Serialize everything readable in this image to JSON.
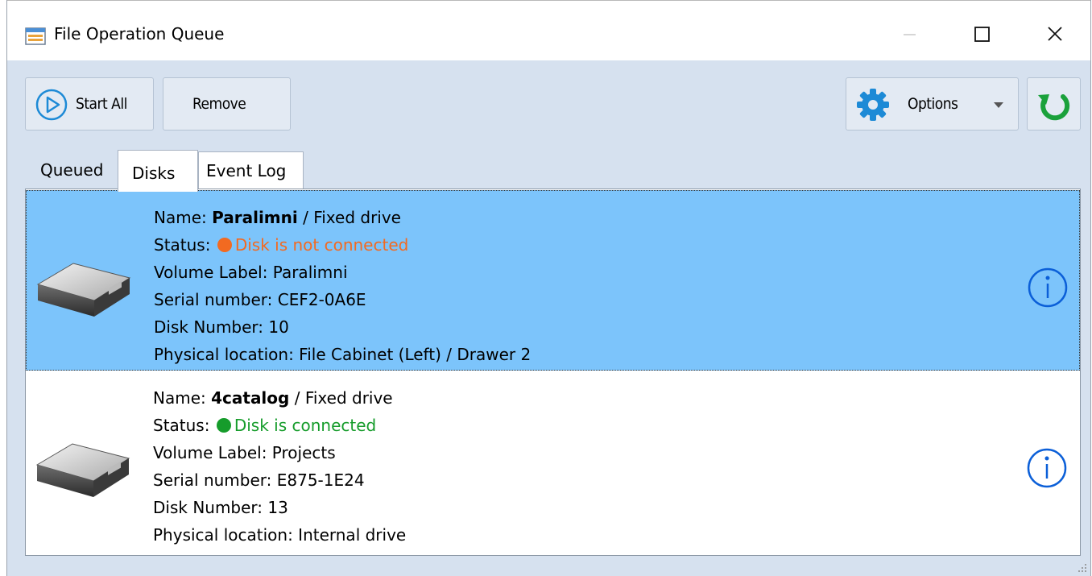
{
  "window": {
    "title": "File Operation Queue"
  },
  "toolbar": {
    "start_all_label": "Start All",
    "remove_label": "Remove",
    "options_label": "Options"
  },
  "tabs": [
    {
      "label": "Queued",
      "active": false
    },
    {
      "label": "Disks",
      "active": true
    },
    {
      "label": "Event Log",
      "active": false
    }
  ],
  "disks": [
    {
      "name_prefix": "Name: ",
      "name": "Paralimni",
      "type": " / Fixed drive",
      "status_prefix": "Status: ",
      "status": "Disk is not connected",
      "status_color": "#f26a21",
      "volume_label": "Volume Label: Paralimni",
      "serial": "Serial number: CEF2-0A6E",
      "disk_number": "Disk Number: 10",
      "location": "Physical location: File Cabinet (Left) / Drawer 2",
      "selected": true
    },
    {
      "name_prefix": "Name: ",
      "name": "4catalog",
      "type": " / Fixed drive",
      "status_prefix": "Status: ",
      "status": "Disk is connected",
      "status_color": "#169c2b",
      "volume_label": "Volume Label: Projects",
      "serial": "Serial number: E875-1E24",
      "disk_number": "Disk Number: 13",
      "location": "Physical location: Internal drive",
      "selected": false
    }
  ],
  "colors": {
    "selection": "#7cc4fb",
    "accent_blue": "#1d8ad6",
    "refresh_green": "#1aa13b",
    "info_blue": "#0b5fd8"
  },
  "icons": {
    "title": "window-queue-icon",
    "start": "play-circle-icon",
    "options": "gear-icon",
    "options_dropdown": "chevron-down-icon",
    "refresh": "refresh-icon",
    "drive": "hard-drive-icon",
    "info": "info-icon"
  }
}
